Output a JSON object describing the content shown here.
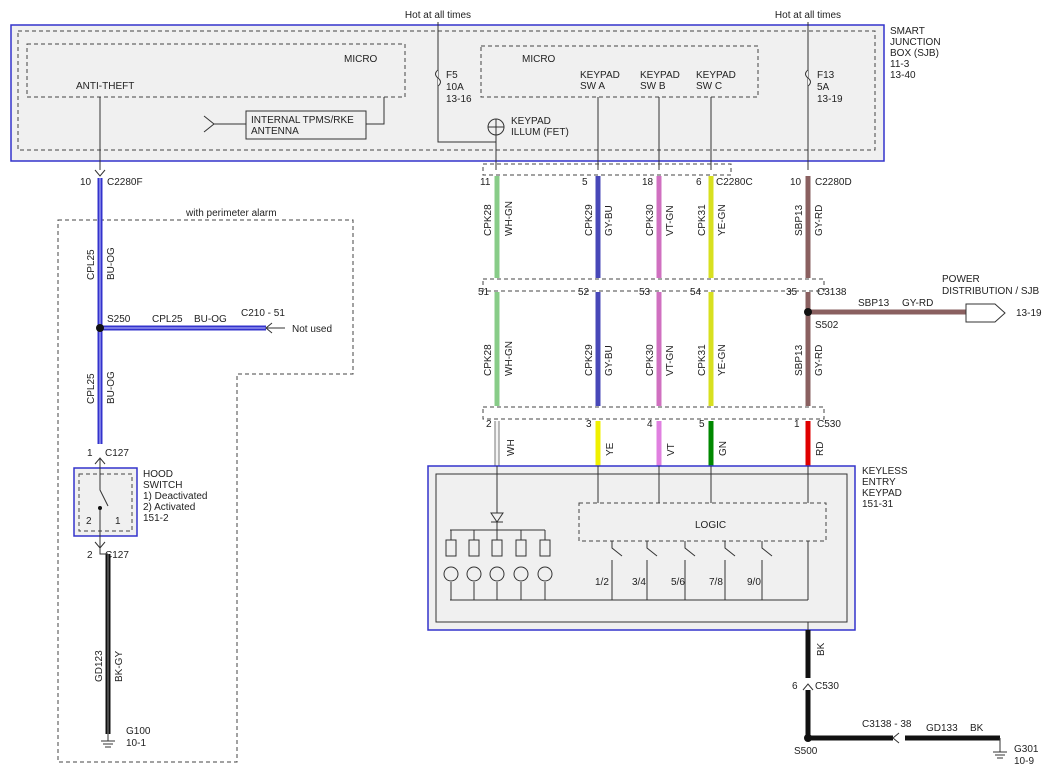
{
  "colors": {
    "blue_og": "#3333cc",
    "wh_gn": "#88cc88",
    "gy_bu": "#4848b8",
    "vt_gn": "#d070c0",
    "ye_gn": "#d8e020",
    "gy_rd": "#8a6060",
    "wh": "#f4f4f4",
    "ye": "#f0f000",
    "vt": "#e080e0",
    "gn": "#008800",
    "rd": "#e00000",
    "bk": "#111111",
    "bk_gy": "#333333",
    "module_border": "#3333cc",
    "module_fill": "#f0f0f0"
  },
  "sjb": {
    "title_lines": [
      "SMART",
      "JUNCTION",
      "BOX (SJB)",
      "11-3",
      "13-40"
    ],
    "hot_left": "Hot at all times",
    "hot_right": "Hot at all times",
    "micro_left": "MICRO",
    "anti_theft": "ANTI-THEFT",
    "antenna_lines": [
      "INTERNAL TPMS/RKE",
      "ANTENNA"
    ],
    "fuse_f5": [
      "F5",
      "10A",
      "13-16"
    ],
    "micro_right": "MICRO",
    "keypad_a": [
      "KEYPAD",
      "SW A"
    ],
    "keypad_b": [
      "KEYPAD",
      "SW B"
    ],
    "keypad_c": [
      "KEYPAD",
      "SW C"
    ],
    "fuse_f13": [
      "F13",
      "5A",
      "13-19"
    ],
    "illum_lines": [
      "KEYPAD",
      "ILLUM (FET)"
    ]
  },
  "connectors": {
    "c2280f_pin": "10",
    "c2280f": "C2280F",
    "c2280c_pins": [
      "11",
      "5",
      "18",
      "6"
    ],
    "c2280c": "C2280C",
    "c2280d_pin": "10",
    "c2280d": "C2280D",
    "c3138_pins": [
      "51",
      "52",
      "53",
      "54",
      "35"
    ],
    "c3138": "C3138",
    "c530_pins": [
      "2",
      "3",
      "4",
      "5",
      "1"
    ],
    "c530": "C530",
    "c127_top_pin": "1",
    "c127_top": "C127",
    "c127_bot_pin": "2",
    "c127_bot": "C127",
    "c530_bk_pin": "6",
    "c530_bk": "C530"
  },
  "left_circuit": {
    "perimeter_label": "with perimeter alarm",
    "upper_circuit": "CPL25",
    "upper_color": "BU-OG",
    "splice": "S250",
    "branch_circuit": "CPL25",
    "branch_color": "BU-OG",
    "branch_connector": "C210 - 51",
    "not_used": "Not used",
    "lower_circuit": "CPL25",
    "lower_color": "BU-OG",
    "hood_lines": [
      "HOOD",
      "SWITCH",
      "1) Deactivated",
      "2) Activated",
      "151-2"
    ],
    "hood_pin_2": "2",
    "hood_pin_1": "1",
    "ground_circuit": "GD123",
    "ground_color": "BK-GY",
    "ground_lines": [
      "G100",
      "10-1"
    ]
  },
  "upper_wires": [
    {
      "circuit": "CPK28",
      "color": "WH-GN"
    },
    {
      "circuit": "CPK29",
      "color": "GY-BU"
    },
    {
      "circuit": "CPK30",
      "color": "VT-GN"
    },
    {
      "circuit": "CPK31",
      "color": "YE-GN"
    },
    {
      "circuit": "SBP13",
      "color": "GY-RD"
    }
  ],
  "lower_wires": [
    {
      "circuit": "CPK28",
      "color": "WH-GN"
    },
    {
      "circuit": "CPK29",
      "color": "GY-BU"
    },
    {
      "circuit": "CPK30",
      "color": "VT-GN"
    },
    {
      "circuit": "CPK31",
      "color": "YE-GN"
    },
    {
      "circuit": "SBP13",
      "color": "GY-RD"
    }
  ],
  "keypad_wire_colors": [
    "WH",
    "YE",
    "VT",
    "GN",
    "RD"
  ],
  "power": {
    "lines": [
      "POWER",
      "DISTRIBUTION / SJB"
    ],
    "circuit": "SBP13",
    "color": "GY-RD",
    "page": "13-19",
    "splice": "S502"
  },
  "keypad": {
    "title_lines": [
      "KEYLESS",
      "ENTRY",
      "KEYPAD",
      "151-31"
    ],
    "logic": "LOGIC",
    "switches": [
      "1/2",
      "3/4",
      "5/6",
      "7/8",
      "9/0"
    ]
  },
  "ground": {
    "bk_label": "BK",
    "splice": "S500",
    "connector": "C3138 - 38",
    "circuit": "GD133",
    "color": "BK",
    "ground_lines": [
      "G301",
      "10-9"
    ]
  }
}
